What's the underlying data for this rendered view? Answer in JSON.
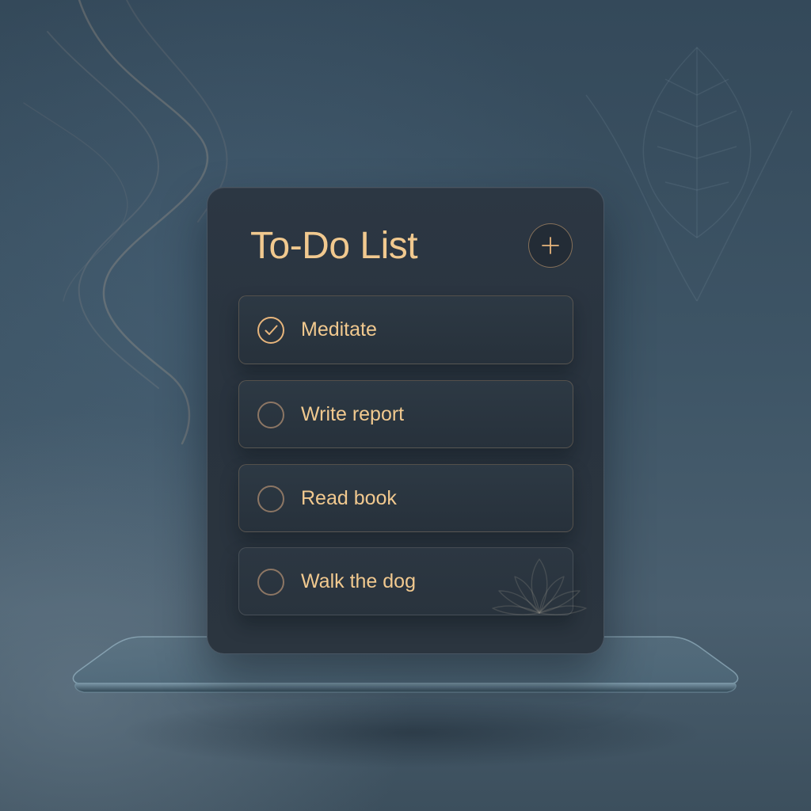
{
  "app": {
    "title": "To-Do List",
    "add_button_icon": "plus-icon"
  },
  "tasks": [
    {
      "label": "Meditate",
      "completed": true,
      "icon": "check-circle-icon"
    },
    {
      "label": "Write report",
      "completed": false,
      "icon": "empty-circle-icon"
    },
    {
      "label": "Read book",
      "completed": false,
      "icon": "empty-circle-icon"
    },
    {
      "label": "Walk the dog",
      "completed": false,
      "icon": "empty-circle-icon"
    }
  ],
  "colors": {
    "accent": "#f1c98f",
    "checkbox_done": "#e7b57c",
    "checkbox_empty": "#8c7664",
    "card_background": "#2a343f",
    "page_background": "#3e5566"
  }
}
